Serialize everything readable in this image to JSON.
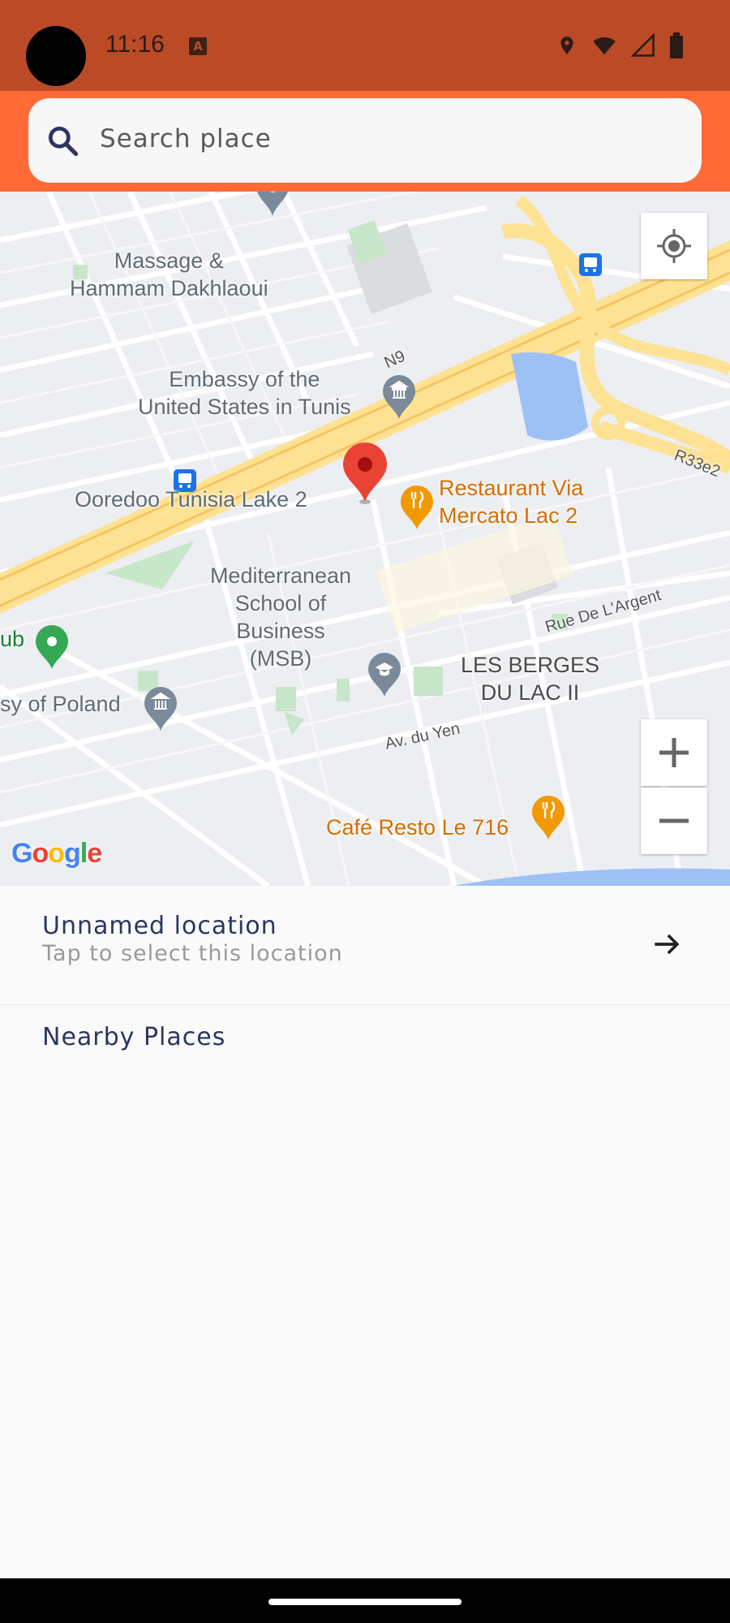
{
  "status_bar": {
    "time": "11:16",
    "notification_letter": "A",
    "icons": [
      "location-icon",
      "wifi-icon",
      "cell-signal-icon",
      "battery-icon"
    ]
  },
  "search": {
    "placeholder": "Search place",
    "icon": "search-icon"
  },
  "map": {
    "labels": [
      "Massage &\nHammam Dakhlaoui",
      "Embassy of the\nUnited States in Tunis",
      "Ooredoo Tunisia Lake 2",
      "Restaurant Via\nMercato Lac 2",
      "Mediterranean\nSchool of\nBusiness\n(MSB)",
      "LES BERGES\nDU LAC II",
      "ub",
      "sy of Poland",
      "Café Resto Le 716",
      "Av. du Yen",
      "Rue De L'Argent",
      "R33e2",
      "N9"
    ],
    "attribution": "Google",
    "controls": [
      "my-location-icon",
      "zoom-in-icon",
      "zoom-out-icon"
    ]
  },
  "selection": {
    "title": "Unnamed location",
    "subtitle": "Tap to select this location"
  },
  "nearby": {
    "heading": "Nearby Places"
  },
  "colors": {
    "status_bar": "#bb4a26",
    "app_bar": "#ff6a36",
    "text_primary": "#2d3560",
    "pin": "#e53935"
  }
}
